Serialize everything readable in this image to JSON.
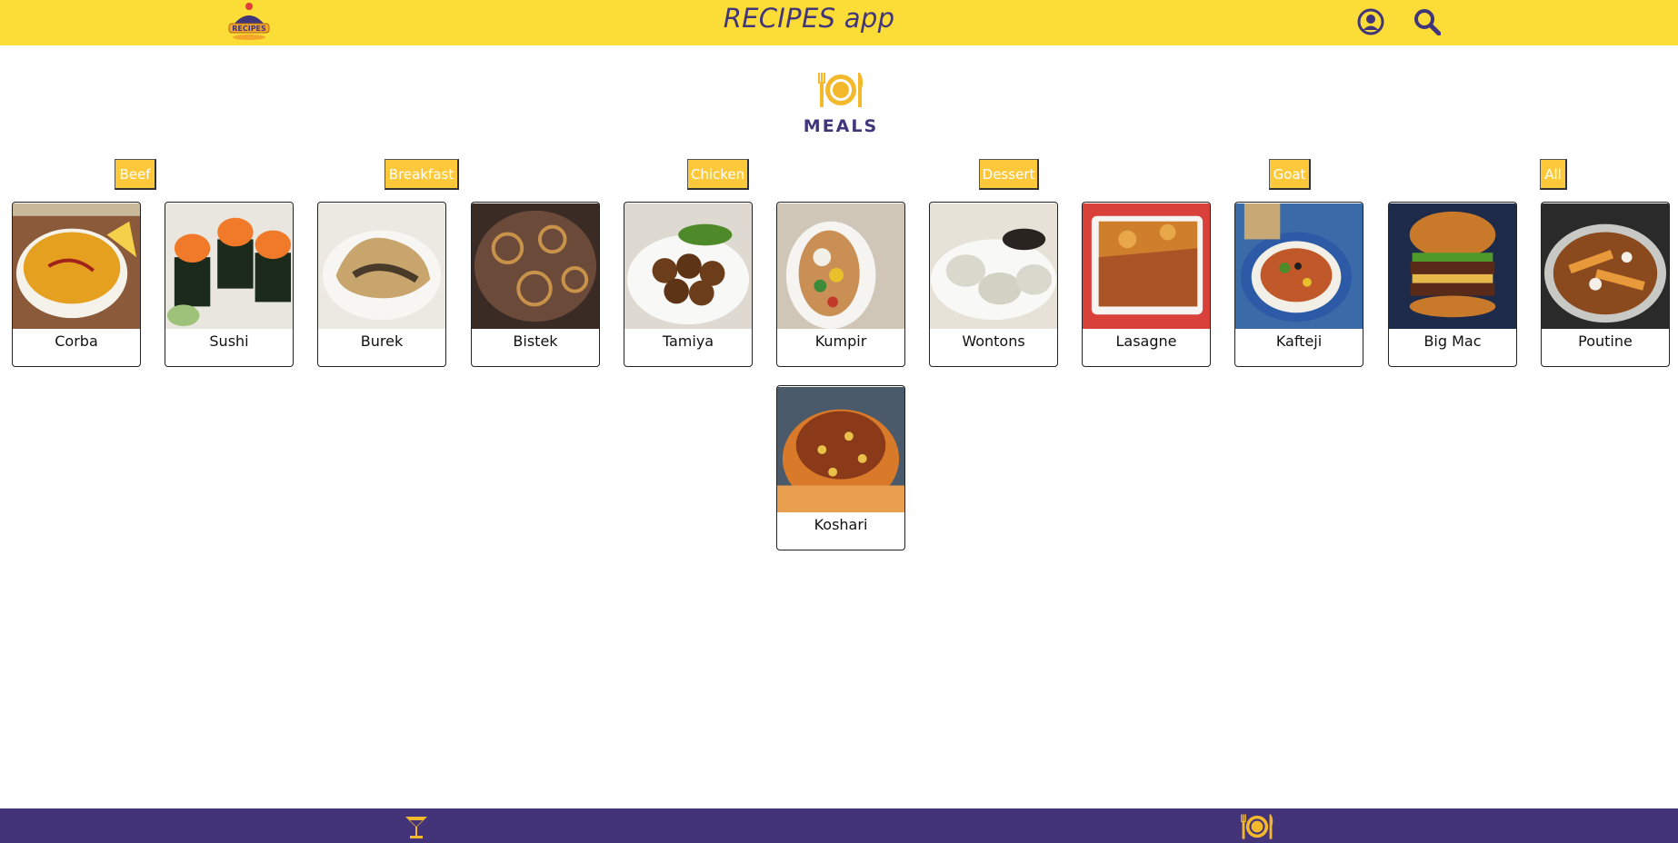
{
  "header": {
    "logo_text": "RECIPES",
    "title": "RECIPES app",
    "profile_icon": "profile-icon",
    "search_icon": "search-icon"
  },
  "page": {
    "title": "MEALS",
    "icon": "plate-cutlery-icon"
  },
  "categories": [
    {
      "label": "Beef"
    },
    {
      "label": "Breakfast"
    },
    {
      "label": "Chicken"
    },
    {
      "label": "Dessert"
    },
    {
      "label": "Goat"
    },
    {
      "label": "All"
    }
  ],
  "meals": [
    {
      "name": "Corba",
      "color": "#e6a020"
    },
    {
      "name": "Sushi",
      "color": "#f07a2a"
    },
    {
      "name": "Burek",
      "color": "#c9a56e"
    },
    {
      "name": "Bistek",
      "color": "#6b4a3a"
    },
    {
      "name": "Tamiya",
      "color": "#6b3d1a"
    },
    {
      "name": "Kumpir",
      "color": "#c98f55"
    },
    {
      "name": "Wontons",
      "color": "#d8d8cc"
    },
    {
      "name": "Lasagne",
      "color": "#cf7e2c"
    },
    {
      "name": "Kafteji",
      "color": "#2c5aa6"
    },
    {
      "name": "Big Mac",
      "color": "#b0692a"
    },
    {
      "name": "Poutine",
      "color": "#c06a2a"
    },
    {
      "name": "Koshari",
      "color": "#c8621e"
    }
  ],
  "footer": {
    "drinks_icon": "cocktail-icon",
    "meals_icon": "plate-cutlery-icon"
  },
  "colors": {
    "header_bg": "#fcdc36",
    "accent_purple": "#41367a",
    "button_yellow": "#fdc93a",
    "footer_bg": "#43347a",
    "icon_orange": "#f4b82c"
  }
}
